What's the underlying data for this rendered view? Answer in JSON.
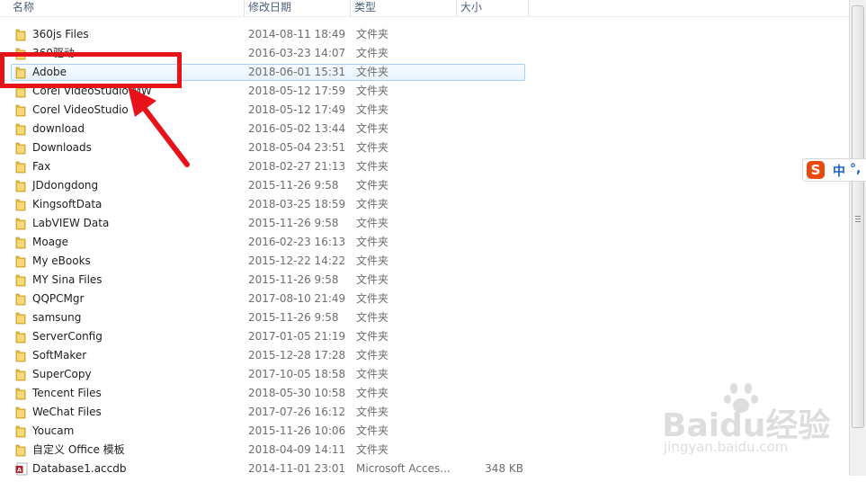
{
  "columns": {
    "name": "名称",
    "date": "修改日期",
    "type": "类型",
    "size": "大小"
  },
  "rows": [
    {
      "name": "360js Files",
      "date": "2014-08-11 18:49",
      "type": "文件夹",
      "size": "",
      "icon": "folder-icon"
    },
    {
      "name": "360驱动",
      "date": "2016-03-23 14:07",
      "type": "文件夹",
      "size": "",
      "icon": "folder-icon"
    },
    {
      "name": "Adobe",
      "date": "2018-06-01 15:31",
      "type": "文件夹",
      "size": "",
      "icon": "folder-icon",
      "selected": true
    },
    {
      "name": "Corel VideoStudio MW",
      "date": "2018-05-12 17:59",
      "type": "文件夹",
      "size": "",
      "icon": "folder-icon"
    },
    {
      "name": "Corel VideoStudio",
      "date": "2018-05-12 17:49",
      "type": "文件夹",
      "size": "",
      "icon": "folder-icon"
    },
    {
      "name": "download",
      "date": "2016-05-02 13:44",
      "type": "文件夹",
      "size": "",
      "icon": "folder-icon"
    },
    {
      "name": "Downloads",
      "date": "2018-05-04 23:51",
      "type": "文件夹",
      "size": "",
      "icon": "folder-icon"
    },
    {
      "name": "Fax",
      "date": "2018-02-27 21:13",
      "type": "文件夹",
      "size": "",
      "icon": "folder-icon"
    },
    {
      "name": "JDdongdong",
      "date": "2015-11-26 9:58",
      "type": "文件夹",
      "size": "",
      "icon": "folder-icon"
    },
    {
      "name": "KingsoftData",
      "date": "2018-03-25 18:59",
      "type": "文件夹",
      "size": "",
      "icon": "folder-icon"
    },
    {
      "name": "LabVIEW Data",
      "date": "2015-11-26 9:58",
      "type": "文件夹",
      "size": "",
      "icon": "folder-icon"
    },
    {
      "name": "Moage",
      "date": "2016-02-23 16:13",
      "type": "文件夹",
      "size": "",
      "icon": "folder-icon"
    },
    {
      "name": "My eBooks",
      "date": "2015-12-22 14:22",
      "type": "文件夹",
      "size": "",
      "icon": "folder-icon"
    },
    {
      "name": "MY Sina Files",
      "date": "2015-11-26 9:58",
      "type": "文件夹",
      "size": "",
      "icon": "folder-icon"
    },
    {
      "name": "QQPCMgr",
      "date": "2017-08-10 21:49",
      "type": "文件夹",
      "size": "",
      "icon": "folder-icon"
    },
    {
      "name": "samsung",
      "date": "2015-11-26 9:58",
      "type": "文件夹",
      "size": "",
      "icon": "folder-icon"
    },
    {
      "name": "ServerConfig",
      "date": "2017-01-05 21:19",
      "type": "文件夹",
      "size": "",
      "icon": "folder-icon"
    },
    {
      "name": "SoftMaker",
      "date": "2015-12-28 17:28",
      "type": "文件夹",
      "size": "",
      "icon": "folder-icon"
    },
    {
      "name": "SuperCopy",
      "date": "2017-10-05 18:58",
      "type": "文件夹",
      "size": "",
      "icon": "folder-icon"
    },
    {
      "name": "Tencent Files",
      "date": "2018-05-30 10:58",
      "type": "文件夹",
      "size": "",
      "icon": "folder-icon"
    },
    {
      "name": "WeChat Files",
      "date": "2017-07-26 16:12",
      "type": "文件夹",
      "size": "",
      "icon": "folder-icon"
    },
    {
      "name": "Youcam",
      "date": "2015-11-26 10:06",
      "type": "文件夹",
      "size": "",
      "icon": "folder-icon"
    },
    {
      "name": "自定义 Office 模板",
      "date": "2018-04-09 14:11",
      "type": "文件夹",
      "size": "",
      "icon": "folder-icon"
    },
    {
      "name": "Database1.accdb",
      "date": "2014-11-01 23:01",
      "type": "Microsoft Acces...",
      "size": "348 KB",
      "icon": "access-file-icon"
    }
  ],
  "ime": {
    "logo": "S",
    "mode": "中",
    "punct": "°,"
  },
  "watermark": {
    "brand": "Baidu经验",
    "sub": "jingyan.baidu.com"
  },
  "colors": {
    "annotation_red": "#e8131a",
    "folder_yellow": "#f2c64c",
    "selection_border": "#a7d0f3",
    "ime_orange": "#e84a0c"
  }
}
